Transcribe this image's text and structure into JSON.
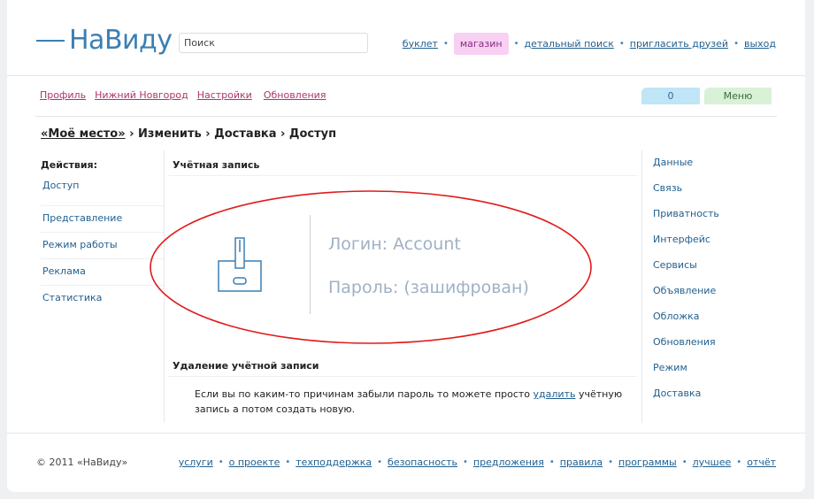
{
  "header": {
    "logo": "НаВиду",
    "search_placeholder": "Поиск",
    "nav": [
      "буклет",
      "магазин",
      "детальный поиск",
      "пригласить друзей",
      "выход"
    ]
  },
  "subnav": {
    "items": [
      "Профиль",
      "Нижний Новгород",
      "Настройки",
      "Обновления"
    ],
    "counter": "0",
    "menu": "Меню"
  },
  "breadcrumb": {
    "home": "«Моё место»",
    "rest": " › Изменить › Доставка › Доступ"
  },
  "left_sidebar": {
    "title": "Действия:",
    "items": [
      "Доступ",
      "Представление",
      "Режим работы",
      "Реклама",
      "Статистика"
    ]
  },
  "account": {
    "title": "Учётная запись",
    "login": "Логин: Account",
    "password": "Пароль: (зашифрован)"
  },
  "delete_section": {
    "title": "Удаление учётной записи",
    "text_before": "Если вы по каким-то причинам забыли пароль то можете просто ",
    "link": "удалить",
    "text_after": " учётную запись а потом создать новую."
  },
  "right_sidebar": {
    "items": [
      "Данные",
      "Связь",
      "Приватность",
      "Интерфейс",
      "Сервисы",
      "Объявление",
      "Обложка",
      "Обновления",
      "Режим",
      "Доставка"
    ]
  },
  "footer": {
    "copyright": "© 2011 «НаВиду»",
    "links": [
      "услуги",
      "о проекте",
      "техподдержка",
      "безопасность",
      "предложения",
      "правила",
      "программы",
      "лучшее",
      "отчёт"
    ]
  },
  "colors": {
    "accent": "#3a7fb3",
    "shop_bg": "#f7d0f3",
    "counter_bg": "#bfe5f6",
    "menu_bg": "#d9f1d6",
    "highlight_ellipse": "#e01b1b"
  }
}
